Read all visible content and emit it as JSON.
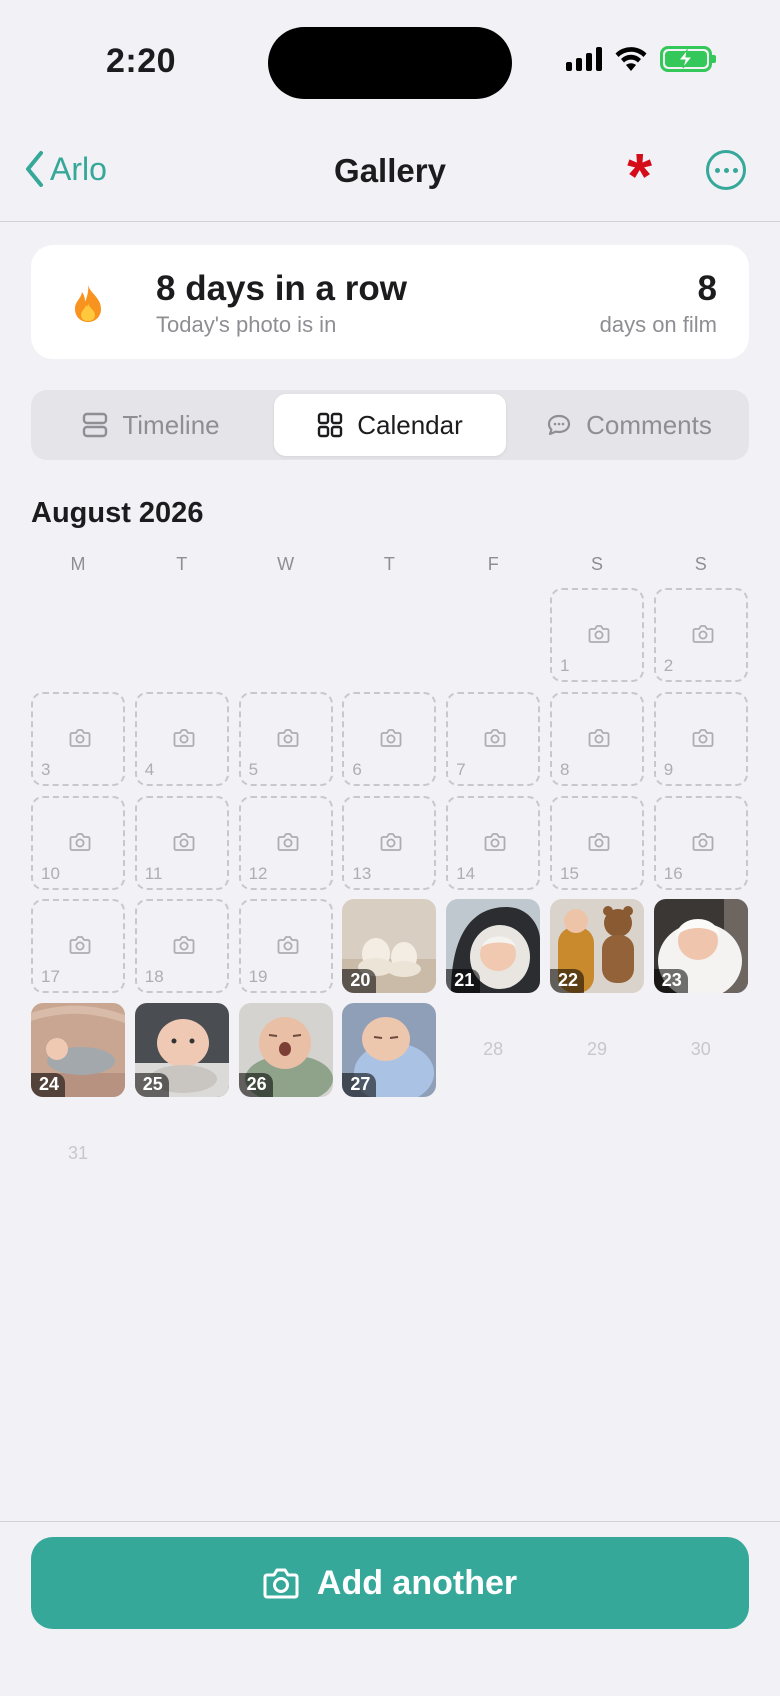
{
  "status_bar": {
    "time": "2:20"
  },
  "nav": {
    "back_label": "Arlo",
    "title": "Gallery",
    "asterisk": "*"
  },
  "streak": {
    "title": "8 days in a row",
    "subtitle": "Today's photo is in",
    "count": "8",
    "count_label": "days on film"
  },
  "tabs": [
    {
      "label": "Timeline",
      "icon": "timeline-icon"
    },
    {
      "label": "Calendar",
      "icon": "grid-icon",
      "active": true
    },
    {
      "label": "Comments",
      "icon": "comment-icon"
    }
  ],
  "calendar": {
    "month": "August 2026",
    "weekdays": [
      "M",
      "T",
      "W",
      "T",
      "F",
      "S",
      "S"
    ],
    "days": [
      {
        "d": "1",
        "state": "empty"
      },
      {
        "d": "2",
        "state": "empty"
      },
      {
        "d": "3",
        "state": "empty"
      },
      {
        "d": "4",
        "state": "empty"
      },
      {
        "d": "5",
        "state": "empty"
      },
      {
        "d": "6",
        "state": "empty"
      },
      {
        "d": "7",
        "state": "empty"
      },
      {
        "d": "8",
        "state": "empty"
      },
      {
        "d": "9",
        "state": "empty"
      },
      {
        "d": "10",
        "state": "empty"
      },
      {
        "d": "11",
        "state": "empty"
      },
      {
        "d": "12",
        "state": "empty"
      },
      {
        "d": "13",
        "state": "empty"
      },
      {
        "d": "14",
        "state": "empty"
      },
      {
        "d": "15",
        "state": "empty"
      },
      {
        "d": "16",
        "state": "empty"
      },
      {
        "d": "17",
        "state": "empty"
      },
      {
        "d": "18",
        "state": "empty"
      },
      {
        "d": "19",
        "state": "empty"
      },
      {
        "d": "20",
        "state": "photo",
        "photo": "baby-booties"
      },
      {
        "d": "21",
        "state": "photo",
        "photo": "baby-in-car-seat"
      },
      {
        "d": "22",
        "state": "photo",
        "photo": "baby-with-teddy-bear"
      },
      {
        "d": "23",
        "state": "photo",
        "photo": "baby-in-white-blanket"
      },
      {
        "d": "24",
        "state": "photo",
        "photo": "baby-sleeping-in-crib"
      },
      {
        "d": "25",
        "state": "photo",
        "photo": "baby-tummy-time"
      },
      {
        "d": "26",
        "state": "photo",
        "photo": "baby-yawning-green-swaddle"
      },
      {
        "d": "27",
        "state": "photo",
        "photo": "baby-blue-swaddle"
      },
      {
        "d": "28",
        "state": "future"
      },
      {
        "d": "29",
        "state": "future"
      },
      {
        "d": "30",
        "state": "future"
      },
      {
        "d": "31",
        "state": "future"
      }
    ]
  },
  "add_button": {
    "label": "Add another"
  },
  "colors": {
    "accent": "#35a899",
    "asterisk": "#d40c1a",
    "background": "#f2f1f6"
  }
}
